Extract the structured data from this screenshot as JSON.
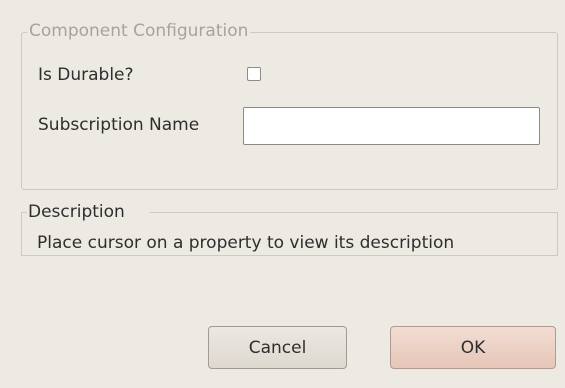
{
  "config_group": {
    "title": "Component Configuration",
    "durable_label": "Is Durable?",
    "durable_checked": false,
    "subscription_label": "Subscription Name",
    "subscription_value": ""
  },
  "description_group": {
    "title": "Description",
    "text": "Place cursor on a property to view its description"
  },
  "buttons": {
    "cancel_label": "Cancel",
    "ok_label": "OK"
  }
}
